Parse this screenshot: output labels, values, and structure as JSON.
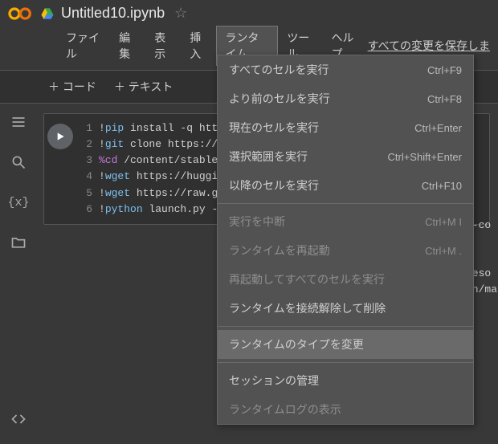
{
  "header": {
    "title": "Untitled10.ipynb"
  },
  "menubar": {
    "file": "ファイル",
    "edit": "編集",
    "view": "表示",
    "insert": "挿入",
    "runtime": "ランタイム",
    "tools": "ツール",
    "help": "ヘルプ",
    "save_all": "すべての変更を保存しま"
  },
  "toolbar": {
    "code_btn": "＋ コード",
    "text_btn": "＋ テキスト"
  },
  "code": {
    "l1": "!pip install -q htt",
    "l2": "!git clone https://",
    "l3_magic": "%cd",
    "l3_rest": " /content/stable",
    "l4": "!wget https://huggi",
    "l5": "!wget https://raw.g",
    "l6": "!python launch.py -"
  },
  "side_fragments": {
    "f1": "i-co",
    "f2": "reso",
    "f3": "on/ma"
  },
  "dropdown": {
    "run_all": {
      "label": "すべてのセルを実行",
      "shortcut": "Ctrl+F9"
    },
    "run_before": {
      "label": "より前のセルを実行",
      "shortcut": "Ctrl+F8"
    },
    "run_current": {
      "label": "現在のセルを実行",
      "shortcut": "Ctrl+Enter"
    },
    "run_selection": {
      "label": "選択範囲を実行",
      "shortcut": "Ctrl+Shift+Enter"
    },
    "run_after": {
      "label": "以降のセルを実行",
      "shortcut": "Ctrl+F10"
    },
    "interrupt": {
      "label": "実行を中断",
      "shortcut": "Ctrl+M I"
    },
    "restart": {
      "label": "ランタイムを再起動",
      "shortcut": "Ctrl+M ."
    },
    "restart_run": {
      "label": "再起動してすべてのセルを実行"
    },
    "disconnect": {
      "label": "ランタイムを接続解除して削除"
    },
    "change_type": {
      "label": "ランタイムのタイプを変更"
    },
    "manage": {
      "label": "セッションの管理"
    },
    "view_logs": {
      "label": "ランタイムログの表示"
    }
  }
}
